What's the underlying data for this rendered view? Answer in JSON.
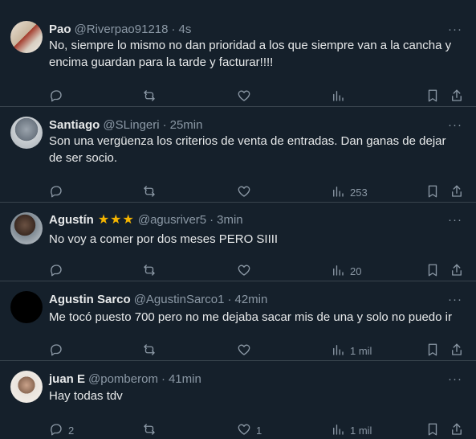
{
  "tweets": [
    {
      "name": "Pao",
      "handle": "@Riverpao91218",
      "sep": "·",
      "time": "4s",
      "text": "No, siempre lo mismo no dan prioridad a los que siempre van a la cancha y encima guardan para la tarde y facturar!!!!",
      "stars": "",
      "reply_count": "",
      "like_count": "",
      "view_count": ""
    },
    {
      "name": "Santiago",
      "handle": "@SLingeri",
      "sep": "·",
      "time": "25min",
      "text": "Son una vergüenza los criterios de venta de entradas. Dan ganas de dejar de ser socio.",
      "stars": "",
      "reply_count": "",
      "like_count": "",
      "view_count": "253"
    },
    {
      "name": "Agustín",
      "handle": "@agusriver5",
      "sep": "·",
      "time": "3min",
      "text": "No voy a comer por dos meses PERO SIIII",
      "stars": "★★★",
      "reply_count": "",
      "like_count": "",
      "view_count": "20"
    },
    {
      "name": "Agustin Sarco",
      "handle": "@AgustinSarco1",
      "sep": "·",
      "time": "42min",
      "text": "Me tocó puesto 700 pero no me dejaba sacar mis de una y solo no puedo ir",
      "stars": "",
      "reply_count": "",
      "like_count": "",
      "view_count": "1 mil"
    },
    {
      "name": "juan E",
      "handle": "@pomberom",
      "sep": "·",
      "time": "41min",
      "text": "Hay todas tdv",
      "stars": "",
      "reply_count": "2",
      "like_count": "1",
      "view_count": "1 mil"
    }
  ],
  "more_glyph": "···",
  "colors": {
    "background": "#15202b",
    "muted": "#8b98a5",
    "text": "#e7e9ea",
    "divider": "#38444d",
    "star": "#f4b400"
  }
}
